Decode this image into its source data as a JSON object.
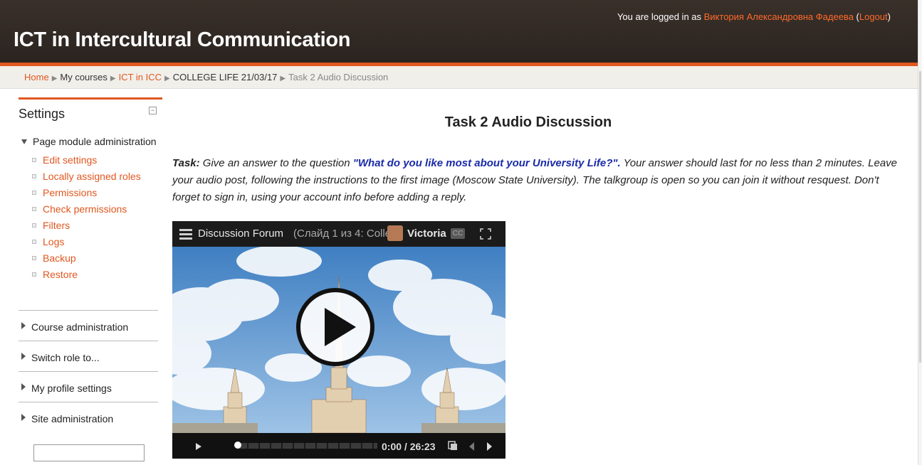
{
  "header": {
    "site_title": "ICT in Intercultural Communication",
    "login_prefix": "You are logged in as ",
    "user_name": "Виктория Александровна Фадеева",
    "logout_open": " (",
    "logout_label": "Logout",
    "logout_close": ")"
  },
  "breadcrumb": {
    "items": [
      "Home",
      "My courses",
      "ICT in ICC",
      "COLLEGE LIFE 21/03/17",
      "Task 2 Audio Discussion"
    ],
    "separator": "▶"
  },
  "settings": {
    "title": "Settings",
    "collapse_symbol": "−",
    "page_module_admin": "Page module administration",
    "items": [
      "Edit settings",
      "Locally assigned roles",
      "Permissions",
      "Check permissions",
      "Filters",
      "Logs",
      "Backup",
      "Restore"
    ],
    "sections": [
      "Course administration",
      "Switch role to...",
      "My profile settings",
      "Site administration"
    ]
  },
  "main": {
    "page_title": "Task 2 Audio Discussion",
    "task_label": "Task:",
    "task_text_1": " Give an answer to the question ",
    "question": "\"What do you like most about your University Life?\".",
    "task_text_2": " Your answer should last for no less than 2 minutes. Leave your audio post, following the instructions to the first image (Moscow State University). The talkgroup is open so you can join it without resquest. Don't forget to sign in, using your account info before adding a reply."
  },
  "player": {
    "title": "Discussion Forum",
    "slide_info": "(Слайд 1 из 4: Colle...",
    "user": "Victoria",
    "cc_label": "CC",
    "time": "0:00 / 26:23",
    "progress_fraction": 0.0
  },
  "colors": {
    "accent": "#e0571f",
    "header_bg": "#2f2823",
    "question": "#1a2ba8"
  }
}
